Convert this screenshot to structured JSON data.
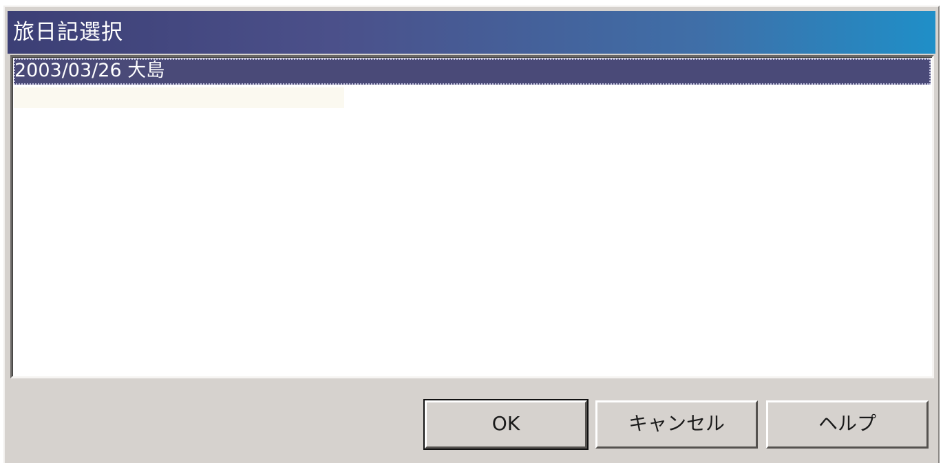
{
  "window": {
    "title": "旅日記選択"
  },
  "list": {
    "items": [
      {
        "label": "2003/03/26 大島",
        "selected": true
      }
    ]
  },
  "buttons": {
    "ok_label": "OK",
    "cancel_label": "キャンセル",
    "help_label": "ヘルプ"
  },
  "colors": {
    "selection": "#4a4a78",
    "dialog_face": "#d6d2ce",
    "title_gradient_start": "#3c3f75",
    "title_gradient_end": "#1f8fc8"
  }
}
